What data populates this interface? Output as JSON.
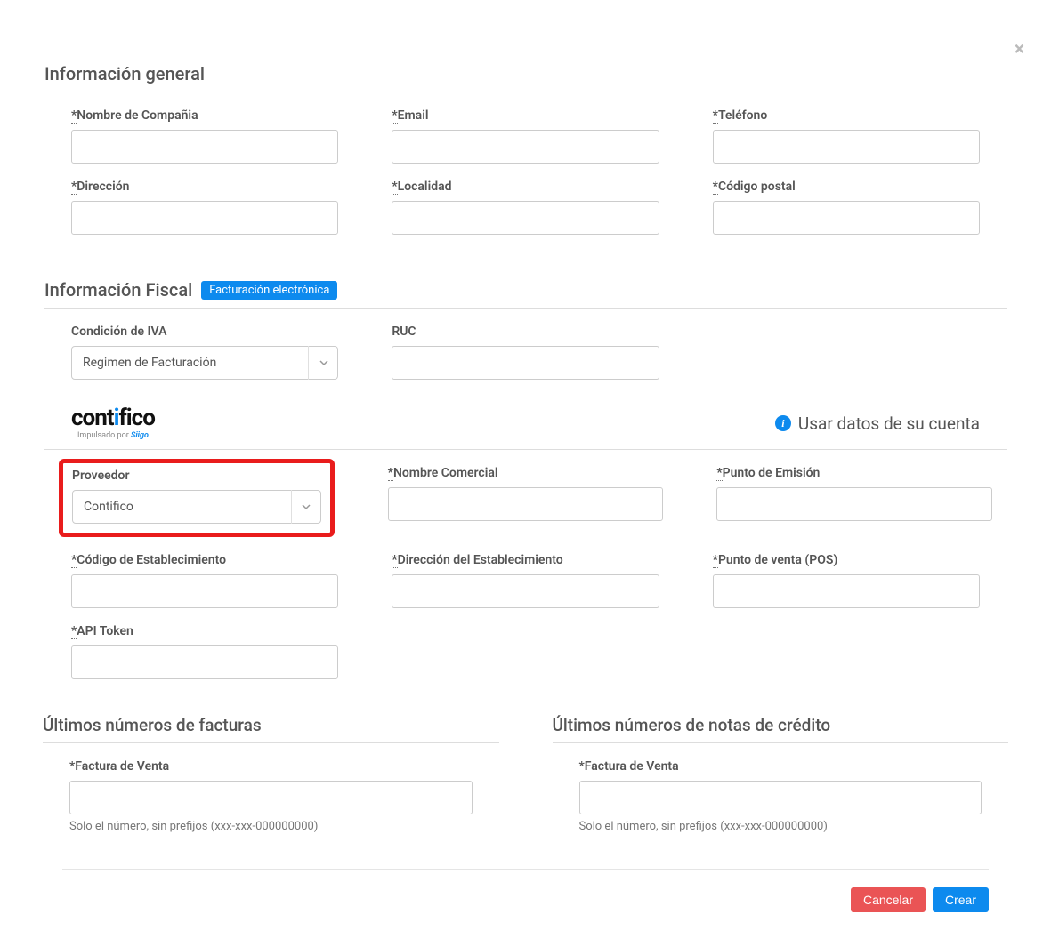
{
  "close_label": "×",
  "sections": {
    "general": {
      "title": "Información general",
      "fields": {
        "company": {
          "label": "Nombre de Compañia",
          "required": "*",
          "value": ""
        },
        "email": {
          "label": "Email",
          "required": "*",
          "value": ""
        },
        "phone": {
          "label": "Teléfono",
          "required": "*",
          "value": ""
        },
        "address": {
          "label": "Dirección",
          "required": "*",
          "value": ""
        },
        "locality": {
          "label": "Localidad",
          "required": "*",
          "value": ""
        },
        "postal": {
          "label": "Código postal",
          "required": "*",
          "value": ""
        }
      }
    },
    "fiscal": {
      "title": "Información Fiscal",
      "badge": "Facturación electrónica",
      "fields": {
        "iva": {
          "label": "Condición de IVA",
          "selected": "Regimen de Facturación"
        },
        "ruc": {
          "label": "RUC",
          "value": ""
        }
      }
    },
    "provider": {
      "logo": {
        "text": "contifico",
        "sub_prefix": "Impulsado por ",
        "sub_brand": "Siigo"
      },
      "use_account": "Usar datos de su cuenta",
      "fields": {
        "provider": {
          "label": "Proveedor",
          "selected": "Contifico"
        },
        "trade_name": {
          "label": "Nombre Comercial",
          "required": "*",
          "value": ""
        },
        "emission_point": {
          "label": "Punto de Emisión",
          "required": "*",
          "value": ""
        },
        "establishment_code": {
          "label": "Código de Establecimiento",
          "required": "*",
          "value": ""
        },
        "establishment_addr": {
          "label": "Dirección del Establecimiento",
          "required": "*",
          "value": ""
        },
        "pos": {
          "label": "Punto de venta (POS)",
          "required": "*",
          "value": ""
        },
        "api_token": {
          "label": "API Token",
          "required": "*",
          "value": ""
        }
      }
    },
    "last_invoices": {
      "title": "Últimos números de facturas",
      "field": {
        "label": "Factura de Venta",
        "required": "*",
        "value": "",
        "help": "Solo el número, sin prefijos (xxx-xxx-000000000)"
      }
    },
    "last_credit": {
      "title": "Últimos números de notas de crédito",
      "field": {
        "label": "Factura de Venta",
        "required": "*",
        "value": "",
        "help": "Solo el número, sin prefijos (xxx-xxx-000000000)"
      }
    }
  },
  "buttons": {
    "cancel": "Cancelar",
    "create": "Crear"
  }
}
